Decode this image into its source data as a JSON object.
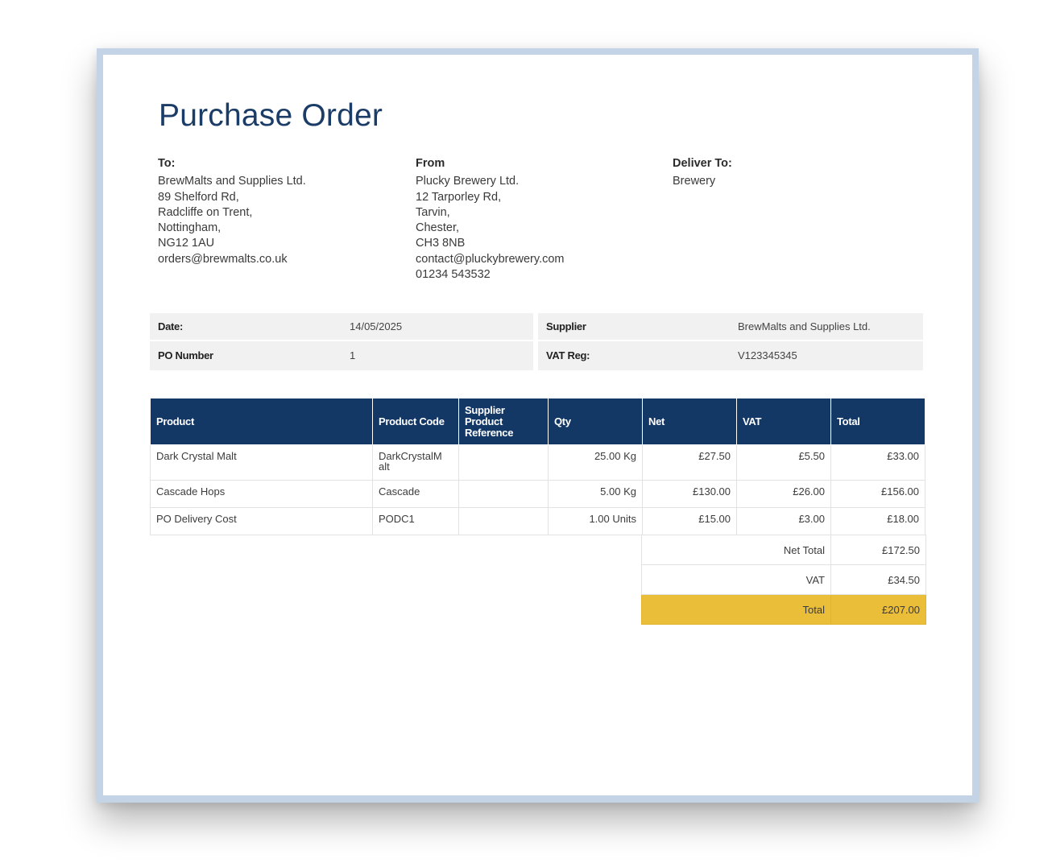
{
  "title": "Purchase Order",
  "to": {
    "heading": "To:",
    "lines": [
      "BrewMalts and Supplies Ltd.",
      "89 Shelford Rd,",
      "Radcliffe on Trent,",
      "Nottingham,",
      "NG12 1AU",
      "orders@brewmalts.co.uk"
    ]
  },
  "from": {
    "heading": "From",
    "lines": [
      "Plucky Brewery Ltd.",
      "12 Tarporley Rd,",
      "Tarvin,",
      "Chester,",
      "CH3 8NB",
      "contact@pluckybrewery.com",
      "01234 543532"
    ]
  },
  "deliver": {
    "heading": "Deliver To:",
    "lines": [
      "Brewery"
    ]
  },
  "info": {
    "date_label": "Date:",
    "date_value": "14/05/2025",
    "po_label": "PO Number",
    "po_value": "1",
    "supplier_label": "Supplier",
    "supplier_value": "BrewMalts and Supplies Ltd.",
    "vat_label": "VAT Reg:",
    "vat_value": "V123345345"
  },
  "table": {
    "headers": {
      "product": "Product",
      "code": "Product Code",
      "supplier_ref_1": "Supplier",
      "supplier_ref_2": "Product",
      "supplier_ref_3": "Reference",
      "qty": "Qty",
      "net": "Net",
      "vat": "VAT",
      "total": "Total"
    },
    "rows": [
      {
        "product": "Dark Crystal Malt",
        "code_1": "DarkCrystalM",
        "code_2": "alt",
        "ref": "",
        "qty": "25.00 Kg",
        "net": "£27.50",
        "vat": "£5.50",
        "total": "£33.00"
      },
      {
        "product": "Cascade Hops",
        "code_1": "Cascade",
        "code_2": "",
        "ref": "",
        "qty": "5.00 Kg",
        "net": "£130.00",
        "vat": "£26.00",
        "total": "£156.00"
      },
      {
        "product": "PO Delivery Cost",
        "code_1": "PODC1",
        "code_2": "",
        "ref": "",
        "qty": "1.00 Units",
        "net": "£15.00",
        "vat": "£3.00",
        "total": "£18.00"
      }
    ]
  },
  "totals": {
    "net_label": "Net Total",
    "net_value": "£172.50",
    "vat_label": "VAT",
    "vat_value": "£34.50",
    "total_label": "Total",
    "total_value": "£207.00"
  },
  "colors": {
    "header_bg": "#143866",
    "title": "#1b3c66",
    "grand_total_bg": "#ebbe3a"
  }
}
